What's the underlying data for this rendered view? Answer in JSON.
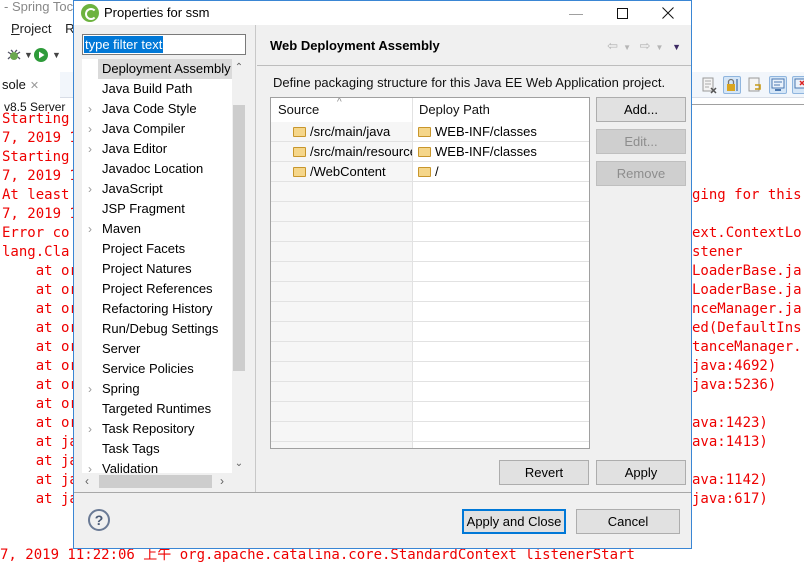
{
  "ide": {
    "title_fragment": "- Spring Toc",
    "menu": [
      {
        "label": "Project",
        "mnemonic": "P"
      },
      {
        "label": "R"
      }
    ],
    "console_tab": {
      "label": "sole",
      "close": "✕"
    },
    "server_label": "v8.5 Server",
    "console_left_lines": [
      "Starting",
      "7, 2019 1",
      "Starting",
      "7, 2019 1",
      "At least",
      "7, 2019 1",
      "Error co",
      "lang.Cla",
      "    at or",
      "    at or",
      "    at or",
      "    at or",
      "    at or",
      "    at or",
      "    at or",
      "    at or",
      "    at or",
      "    at ja",
      "    at ja",
      "    at ja",
      "    at ja"
    ],
    "console_right_lines": [
      {
        "row": 4,
        "text": "ging for this"
      },
      {
        "row": 6,
        "text": "ext.ContextLo"
      },
      {
        "row": 7,
        "text": "stener"
      },
      {
        "row": 8,
        "text": "LoaderBase.ja"
      },
      {
        "row": 9,
        "text": "LoaderBase.ja"
      },
      {
        "row": 10,
        "text": "nceManager.ja"
      },
      {
        "row": 11,
        "text": "ed(DefaultIns"
      },
      {
        "row": 12,
        "text": "tanceManager."
      },
      {
        "row": 13,
        "text": "java:4692)"
      },
      {
        "row": 14,
        "text": "java:5236)"
      },
      {
        "row": 16,
        "text": "ava:1423)"
      },
      {
        "row": 17,
        "text": "ava:1413)"
      },
      {
        "row": 19,
        "text": "ava:1142)"
      },
      {
        "row": 20,
        "text": "java:617)"
      }
    ],
    "console_bottom_line": "7, 2019 11:22:06 上午 org.apache.catalina.core.StandardContext listenerStart",
    "colors": {
      "console_error": "#e00000",
      "accent": "#0078d7"
    }
  },
  "dialog": {
    "title": "Properties for ssm",
    "window_controls": {
      "minimize": "—",
      "maximize": "☐",
      "close": "✕"
    },
    "filter": {
      "value": "type filter text",
      "selected": true
    },
    "tree": {
      "items": [
        {
          "label": "Deployment Assembly",
          "expandable": false,
          "selected": true
        },
        {
          "label": "Java Build Path",
          "expandable": false
        },
        {
          "label": "Java Code Style",
          "expandable": true
        },
        {
          "label": "Java Compiler",
          "expandable": true
        },
        {
          "label": "Java Editor",
          "expandable": true
        },
        {
          "label": "Javadoc Location",
          "expandable": false
        },
        {
          "label": "JavaScript",
          "expandable": true
        },
        {
          "label": "JSP Fragment",
          "expandable": false
        },
        {
          "label": "Maven",
          "expandable": true
        },
        {
          "label": "Project Facets",
          "expandable": false
        },
        {
          "label": "Project Natures",
          "expandable": false
        },
        {
          "label": "Project References",
          "expandable": false
        },
        {
          "label": "Refactoring History",
          "expandable": false
        },
        {
          "label": "Run/Debug Settings",
          "expandable": false
        },
        {
          "label": "Server",
          "expandable": false
        },
        {
          "label": "Service Policies",
          "expandable": false
        },
        {
          "label": "Spring",
          "expandable": true
        },
        {
          "label": "Targeted Runtimes",
          "expandable": false
        },
        {
          "label": "Task Repository",
          "expandable": true
        },
        {
          "label": "Task Tags",
          "expandable": false
        },
        {
          "label": "Validation",
          "expandable": true
        }
      ]
    },
    "page": {
      "title": "Web Deployment Assembly",
      "description": "Define packaging structure for this Java EE Web Application project.",
      "table": {
        "columns": [
          "Source",
          "Deploy Path"
        ],
        "sort_indicator": "^",
        "rows": [
          {
            "source": "/src/main/java",
            "deploy_path": "WEB-INF/classes"
          },
          {
            "source": "/src/main/resources",
            "deploy_path": "WEB-INF/classes"
          },
          {
            "source": "/WebContent",
            "deploy_path": "/"
          }
        ]
      },
      "buttons": {
        "add": "Add...",
        "edit": "Edit...",
        "remove": "Remove",
        "revert": "Revert",
        "apply": "Apply"
      }
    },
    "footer": {
      "apply_close": "Apply and Close",
      "cancel": "Cancel",
      "help": "?"
    }
  }
}
